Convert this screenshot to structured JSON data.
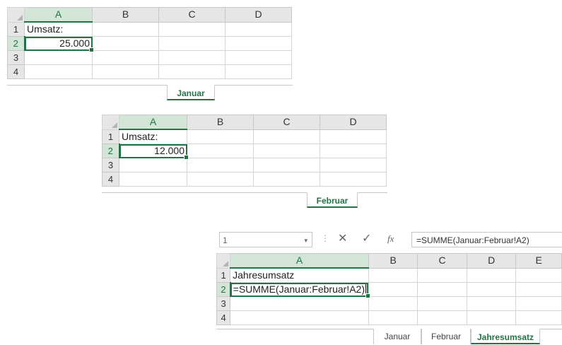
{
  "columns_abcd": [
    "A",
    "B",
    "C",
    "D"
  ],
  "columns_abcde": [
    "A",
    "B",
    "C",
    "D",
    "E"
  ],
  "rows4": [
    "1",
    "2",
    "3",
    "4"
  ],
  "januar": {
    "a1": "Umsatz:",
    "a2": "25.000",
    "tab": "Januar"
  },
  "februar": {
    "a1": "Umsatz:",
    "a2": "12.000",
    "tab": "Februar"
  },
  "jahres": {
    "namebox": "1",
    "formula_bar": "=SUMME(Januar:Februar!A2)",
    "a1": "Jahresumsatz",
    "a2": "=SUMME(Januar:Februar!A2)",
    "tabs": [
      "Januar",
      "Februar",
      "Jahresumsatz"
    ]
  },
  "icons": {
    "cancel": "✕",
    "enter": "✓",
    "fx": "fx",
    "dropdown": "▾",
    "separator": "⋮"
  },
  "colors": {
    "excel_green": "#217346",
    "header_gray": "#e6e6e6",
    "selected_header": "#d3e5d7"
  }
}
